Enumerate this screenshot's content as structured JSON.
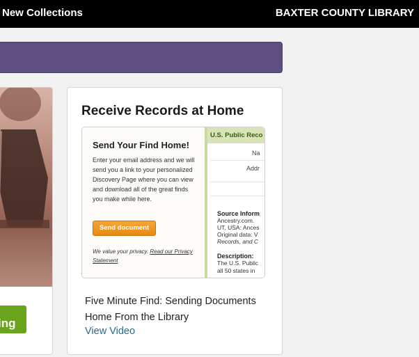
{
  "header": {
    "nav_link": "New Collections",
    "brand": "BAXTER COUNTY LIBRARY"
  },
  "left_card": {
    "button_label": "ing"
  },
  "record_card": {
    "title": "Receive Records at Home",
    "preview": {
      "heading": "Send Your Find Home!",
      "body": "Enter your email address and we will send you a link to your personalized Discovery Page where you can view and download all of the great finds you make while here.",
      "button": "Send document",
      "privacy_text": "We value your privacy.",
      "privacy_link": "Read our Privacy Statement",
      "side_panel": {
        "header": "U.S. Public Reco",
        "label_name": "Na",
        "label_address": "Addr",
        "source_title": "Source Inform",
        "source_lines": [
          "Ancestry.com.",
          "UT, USA: Ances",
          "Original data: V",
          "Records, and C"
        ],
        "description_title": "Description:",
        "description_lines": [
          "The U.S. Public",
          "all 50 states in"
        ]
      }
    },
    "caption": "Five Minute Find: Sending Documents Home From the Library",
    "link": "View Video"
  },
  "colors": {
    "header_bg": "#000000",
    "banner": "#5e4f80",
    "green_button": "#6aa31c",
    "orange_button": "#e58a12",
    "link": "#2a6a8c"
  }
}
